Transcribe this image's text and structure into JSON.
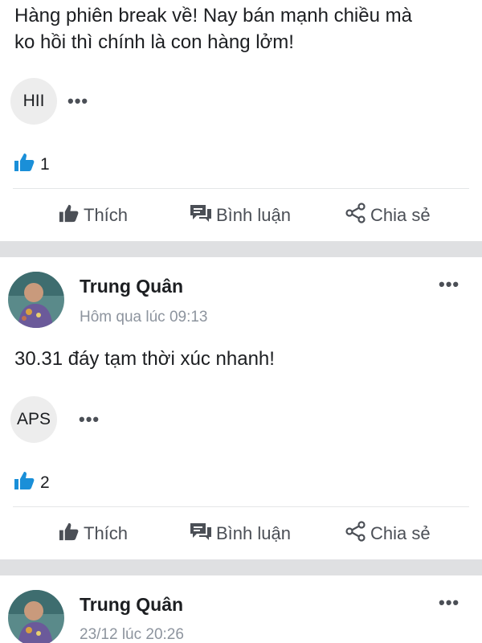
{
  "post1": {
    "text_line1": "Hàng phiên break về! Nay bán mạnh   chiều mà",
    "text_line2": "ko hồi thì chính là con hàng lởm!",
    "tag": "HII",
    "tag_more": "•••",
    "like_count": "1"
  },
  "post2": {
    "author": "Trung Quân",
    "time": "Hôm qua lúc 09:13",
    "more": "•••",
    "text": "30.31 đáy tạm thời xúc nhanh!",
    "tag": "APS",
    "tag_more": "•••",
    "like_count": "2"
  },
  "post3": {
    "author": "Trung Quân",
    "time": "23/12 lúc 20:26",
    "more": "•••"
  },
  "actions": {
    "like": "Thích",
    "comment": "Bình luận",
    "share": "Chia sẻ"
  },
  "icons": {
    "like": "thumbs-up-icon",
    "comment": "comment-icon",
    "share": "share-icon",
    "reaction": "like-reaction-icon"
  },
  "colors": {
    "reaction_blue": "#1a8fd8",
    "action_gray": "#4b4f56",
    "time_gray": "#8d949e",
    "divider": "#dfe0e2"
  }
}
